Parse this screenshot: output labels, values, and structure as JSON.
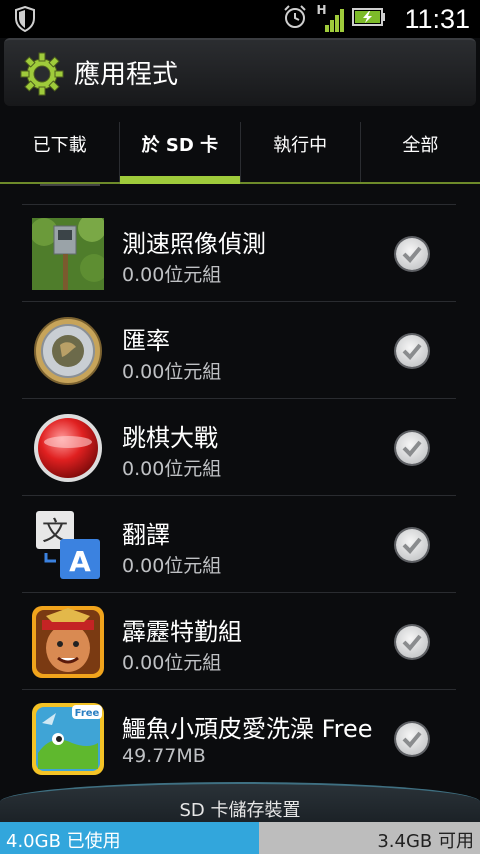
{
  "status_bar": {
    "time": "11:31",
    "network": "H"
  },
  "header": {
    "title": "應用程式"
  },
  "tabs": [
    {
      "label": "已下載",
      "active": false
    },
    {
      "label": "於 SD 卡",
      "active": true
    },
    {
      "label": "執行中",
      "active": false
    },
    {
      "label": "全部",
      "active": false
    }
  ],
  "apps": [
    {
      "name": "測速照像偵測",
      "size": "0.00位元組",
      "icon": "speed-camera-icon",
      "checked": true
    },
    {
      "name": "匯率",
      "size": "0.00位元組",
      "icon": "exchange-rate-coin-icon",
      "checked": true
    },
    {
      "name": "跳棋大戰",
      "size": "0.00位元組",
      "icon": "checkers-battle-icon",
      "checked": true
    },
    {
      "name": "翻譯",
      "size": "0.00位元組",
      "icon": "translate-icon",
      "checked": true
    },
    {
      "name": "霹靂特勤組",
      "size": "0.00位元組",
      "icon": "commando-game-icon",
      "checked": true
    },
    {
      "name": "鱷魚小頑皮愛洗澡 Free",
      "size": "49.77MB",
      "icon": "crocodile-game-icon",
      "checked": true
    }
  ],
  "storage": {
    "label": "SD 卡儲存裝置",
    "used": "4.0GB 已使用",
    "free": "3.4GB 可用",
    "used_fraction": 0.54
  },
  "colors": {
    "accent_green": "#9fcb3b",
    "storage_used": "#32a6dc",
    "storage_free": "#bdbdbd"
  }
}
